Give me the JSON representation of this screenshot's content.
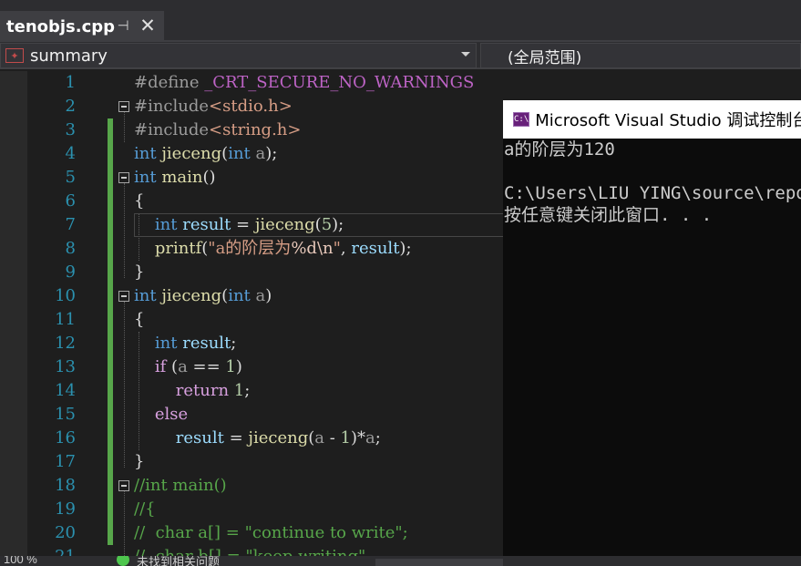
{
  "tab": {
    "title": "tenobjs.cpp",
    "pin_icon": "pin-icon",
    "close_icon": "close-icon"
  },
  "navbar": {
    "member_icon": "member-icon",
    "member": "summary",
    "scope": "(全局范围)"
  },
  "editor": {
    "line_numbers": [
      "1",
      "2",
      "3",
      "4",
      "5",
      "6",
      "7",
      "8",
      "9",
      "10",
      "11",
      "12",
      "13",
      "14",
      "15",
      "16",
      "17",
      "18",
      "19",
      "20",
      "21"
    ]
  },
  "code": {
    "l1": {
      "pp": "#define ",
      "macro": "_CRT_SECURE_NO_WARNINGS"
    },
    "l2": {
      "pp": "#include",
      "str": "<stdio.h>"
    },
    "l3": {
      "pp": "#include",
      "str": "<string.h>"
    },
    "l4": {
      "kw1": "int",
      "fn": "jieceng",
      "p1": "(",
      "kw2": "int",
      "param": "a",
      "p2": ");"
    },
    "l5": {
      "kw": "int",
      "fn": "main",
      "p": "()"
    },
    "l6": {
      "p": "{"
    },
    "l7": {
      "kw": "int",
      "var": "result",
      "op": " = ",
      "fn": "jieceng",
      "p1": "(",
      "num": "5",
      "p2": ");"
    },
    "l8": {
      "fn": "printf",
      "p1": "(",
      "str1": "\"a的阶层为",
      "fmt": "%d\\n",
      "str2": "\"",
      "p2": ", ",
      "var": "result",
      "p3": ");"
    },
    "l9": {
      "p": "}"
    },
    "l10": {
      "kw1": "int",
      "fn": "jieceng",
      "p1": "(",
      "kw2": "int",
      "param": "a",
      "p2": ")"
    },
    "l11": {
      "p": "{"
    },
    "l12": {
      "kw": "int",
      "var": "result",
      "p": ";"
    },
    "l13": {
      "ctl": "if",
      "p1": " (",
      "param": "a",
      "op": " == ",
      "num": "1",
      "p2": ")"
    },
    "l14": {
      "ctl": "return",
      "num": "1",
      "p": ";"
    },
    "l15": {
      "ctl": "else"
    },
    "l16": {
      "var": "result",
      "op": " = ",
      "fn": "jieceng",
      "p1": "(",
      "param": "a",
      "op2": " - ",
      "num": "1",
      "p2": ")*",
      "param2": "a",
      "p3": ";"
    },
    "l17": {
      "p": "}"
    },
    "l18": {
      "cmt": "//int main()"
    },
    "l19": {
      "cmt": "//{"
    },
    "l20": {
      "cmt": "//  char a[] = \"continue to write\";"
    },
    "l21": {
      "cmt": "//  char b[] = \"keep writing\""
    }
  },
  "console": {
    "title_icon": "console-app-icon",
    "title": "Microsoft Visual Studio 调试控制台",
    "lines": [
      "a的阶层为120",
      "",
      "C:\\Users\\LIU YING\\source\\repos",
      "按任意键关闭此窗口. . ."
    ]
  },
  "status": {
    "zoom": "100 %",
    "issues_icon": "check-circle-icon",
    "issues": "未找到相关问题"
  }
}
